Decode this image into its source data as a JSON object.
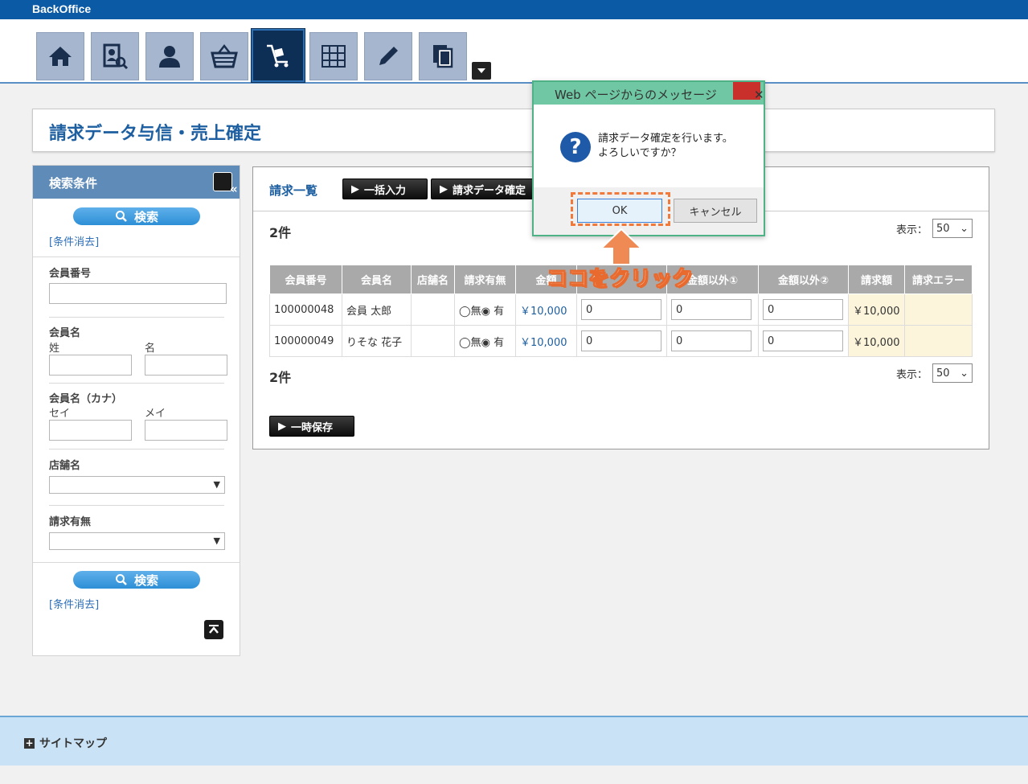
{
  "app": {
    "brand": "BackOffice"
  },
  "nav": {
    "icons": [
      "home-icon",
      "member-search-icon",
      "user-icon",
      "basket-icon",
      "cart-icon",
      "grid-icon",
      "pencil-icon",
      "documents-icon"
    ],
    "active_index": 4
  },
  "page": {
    "title": "請求データ与信・売上確定"
  },
  "sidebar": {
    "title": "検索条件",
    "search_label": "検索",
    "clear_label": "[条件消去]",
    "member_no_label": "会員番号",
    "member_name_label": "会員名",
    "last_name_label": "姓",
    "first_name_label": "名",
    "member_kana_label": "会員名（カナ）",
    "last_kana_label": "セイ",
    "first_kana_label": "メイ",
    "store_label": "店舗名",
    "billing_label": "請求有無"
  },
  "main": {
    "title": "請求一覧",
    "bulk_label": "一括入力",
    "confirm_label": "請求データ確定",
    "count_text": "2件",
    "display_label": "表示：",
    "display_value": "50",
    "save_label": "一時保存",
    "columns": [
      "会員番号",
      "会員名",
      "店舗名",
      "請求有無",
      "金額",
      "金額以外①",
      "金額以外②",
      "請求額",
      "請求エラー"
    ],
    "rows": [
      {
        "member_no": "100000048",
        "name": "会員 太郎",
        "store": "",
        "none_label": "無",
        "yes_label": "有",
        "amount": "￥10,000",
        "val1": "0",
        "val2": "0",
        "val3": "0",
        "billed": "￥10,000",
        "error": ""
      },
      {
        "member_no": "100000049",
        "name": "りそな 花子",
        "store": "",
        "none_label": "無",
        "yes_label": "有",
        "amount": "￥10,000",
        "val1": "0",
        "val2": "0",
        "val3": "0",
        "billed": "￥10,000",
        "error": ""
      }
    ]
  },
  "dialog": {
    "title": "Web ページからのメッセージ",
    "close": "✕",
    "line1": "請求データ確定を行います。",
    "line2": "よろしいですか？",
    "ok_label": "OK",
    "cancel_label": "キャンセル"
  },
  "annotation": {
    "text": "ココをクリック"
  },
  "footer": {
    "sitemap_label": "サイトマップ"
  },
  "colors": {
    "brand_blue": "#0b5aa6",
    "accent_orange": "#ef7a3c",
    "dialog_green": "#6fc7a4"
  }
}
